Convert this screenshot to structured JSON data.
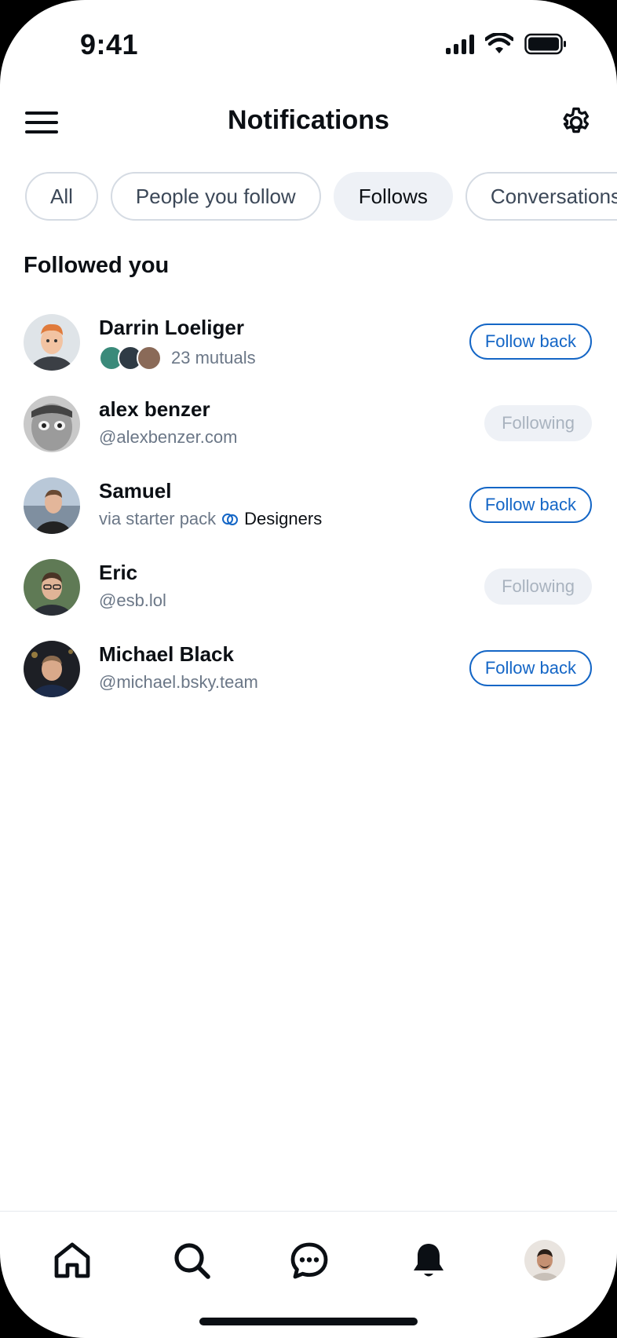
{
  "status_bar": {
    "time": "9:41"
  },
  "header": {
    "title": "Notifications"
  },
  "filters": [
    {
      "label": "All",
      "active": false
    },
    {
      "label": "People you follow",
      "active": false
    },
    {
      "label": "Follows",
      "active": true
    },
    {
      "label": "Conversations",
      "active": false
    }
  ],
  "section": {
    "title": "Followed you"
  },
  "people": [
    {
      "name": "Darrin Loeliger",
      "sub": "23 mutuals",
      "action": "Follow back"
    },
    {
      "name": "alex benzer",
      "sub": "@alexbenzer.com",
      "action": "Following"
    },
    {
      "name": "Samuel",
      "sub_prefix": "via starter pack",
      "sub_pack": "Designers",
      "action": "Follow back"
    },
    {
      "name": "Eric",
      "sub": "@esb.lol",
      "action": "Following"
    },
    {
      "name": "Michael Black",
      "sub": "@michael.bsky.team",
      "action": "Follow back"
    }
  ],
  "tabbar": {
    "tabs": [
      "home-icon",
      "search-icon",
      "chat-icon",
      "bell-icon",
      "profile-avatar"
    ]
  },
  "colors": {
    "accent": "#1466c6",
    "text": "#0b0f14",
    "muted": "#6b7787",
    "chip_active": "#eef1f6"
  }
}
